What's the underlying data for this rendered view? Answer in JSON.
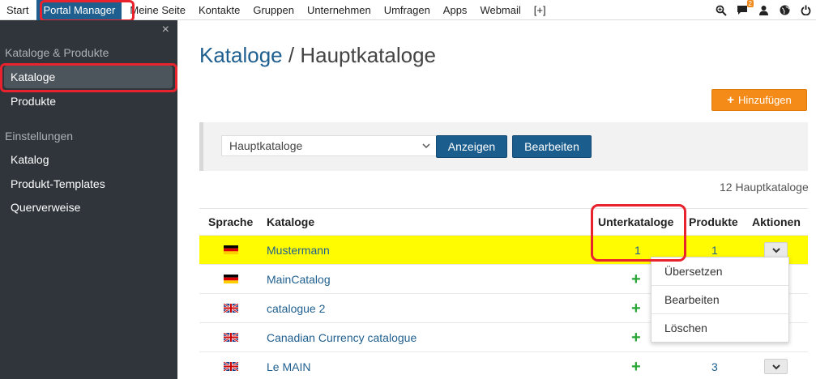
{
  "topnav": {
    "items": [
      "Start",
      "Portal Manager",
      "Meine Seite",
      "Kontakte",
      "Gruppen",
      "Unternehmen",
      "Umfragen",
      "Apps",
      "Webmail",
      "[+]"
    ],
    "notification_count": "2"
  },
  "sidebar": {
    "close": "×",
    "section1": "Kataloge & Produkte",
    "items1": [
      "Kataloge",
      "Produkte"
    ],
    "section2": "Einstellungen",
    "items2": [
      "Katalog",
      "Produkt-Templates",
      "Querverweise"
    ]
  },
  "main": {
    "breadcrumb": "Kataloge",
    "separator": " / ",
    "title": "Hauptkataloge",
    "add_label": "Hinzufügen",
    "select_value": "Hauptkataloge",
    "show_label": "Anzeigen",
    "edit_label": "Bearbeiten",
    "count_text": "12 Hauptkataloge"
  },
  "table": {
    "headers": [
      "Sprache",
      "Kataloge",
      "Unterkataloge",
      "Produkte",
      "Aktionen"
    ],
    "rows": [
      {
        "lang": "de",
        "name": "Mustermann",
        "sub": "1",
        "products": "1"
      },
      {
        "lang": "de",
        "name": "MainCatalog",
        "sub": "+",
        "products": ""
      },
      {
        "lang": "en",
        "name": "catalogue 2",
        "sub": "+",
        "products": ""
      },
      {
        "lang": "en",
        "name": "Canadian Currency catalogue",
        "sub": "+",
        "products": ""
      },
      {
        "lang": "en",
        "name": "Le MAIN",
        "sub": "+",
        "products": "3"
      }
    ]
  },
  "dropdown": {
    "items": [
      "Übersetzen",
      "Bearbeiten",
      "Löschen"
    ]
  },
  "colors": {
    "brand_blue": "#1f5f8f",
    "orange": "#f48b18",
    "highlight_yellow": "#fffb00",
    "annotation_red": "#e8232e",
    "sidebar_bg": "#2f353b"
  }
}
